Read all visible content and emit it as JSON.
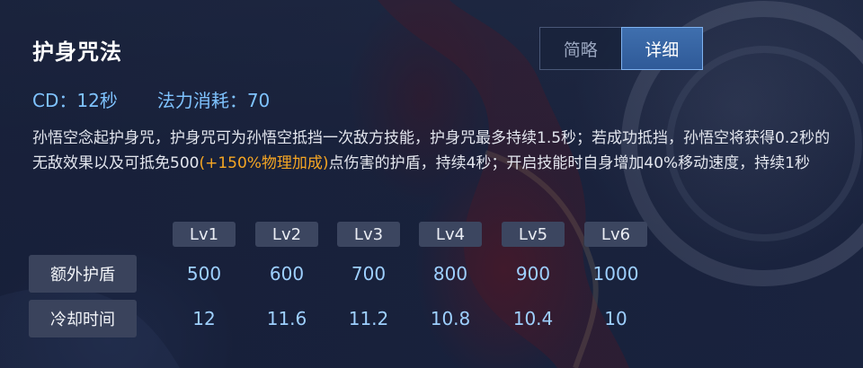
{
  "skill": {
    "title": "护身咒法"
  },
  "view_toggle": {
    "brief_label": "简略",
    "detail_label": "详细",
    "selected": "详细"
  },
  "stats": {
    "cd_label": "CD：",
    "cd_value": "12秒",
    "cost_label": "法力消耗：",
    "cost_value": "70"
  },
  "description": {
    "part1": "孙悟空念起护身咒，护身咒可为孙悟空抵挡一次敌方技能，护身咒最多持续1.5秒；若成功抵挡，孙悟空将",
    "underlined": "获得0.2秒的无敌效果",
    "part2": "以及可抵免500",
    "bonus": "(+150%物理加成)",
    "part3": "点伤害的护盾，持续4秒；开启技能时自身增加40%移动速度，持续1秒"
  },
  "level_table": {
    "levels": [
      "Lv1",
      "Lv2",
      "Lv3",
      "Lv4",
      "Lv5",
      "Lv6"
    ],
    "rows": [
      {
        "label": "额外护盾",
        "values": [
          "500",
          "600",
          "700",
          "800",
          "900",
          "1000"
        ]
      },
      {
        "label": "冷却时间",
        "values": [
          "12",
          "11.6",
          "11.2",
          "10.8",
          "10.4",
          "10"
        ]
      }
    ]
  },
  "colors": {
    "stat_blue": "#7fc3ff",
    "bonus_orange": "#f5a623",
    "underline_red": "#e8242c",
    "active_tab": "#3f6fae"
  }
}
